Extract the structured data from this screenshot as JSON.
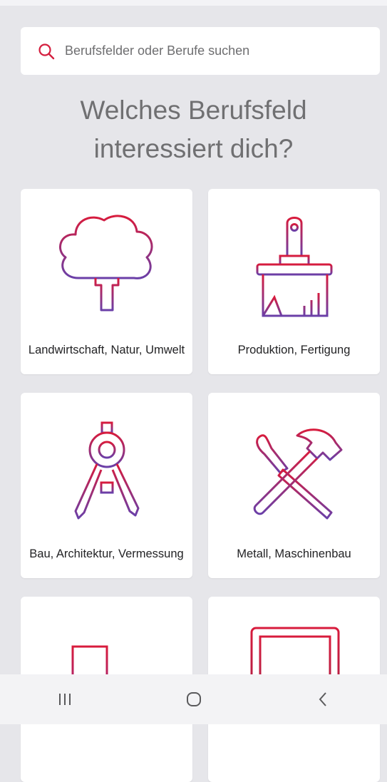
{
  "search": {
    "placeholder": "Berufsfelder oder Berufe suchen",
    "icon": "search-icon"
  },
  "heading": {
    "line1": "Welches Berufsfeld",
    "line2": "interessiert dich?"
  },
  "categories": [
    {
      "label": "Landwirtschaft, Natur, Umwelt",
      "icon": "tree-icon"
    },
    {
      "label": "Produktion, Fertigung",
      "icon": "paintbrush-icon"
    },
    {
      "label": "Bau, Architektur, Vermessung",
      "icon": "compass-icon"
    },
    {
      "label": "Metall, Maschinenbau",
      "icon": "hammer-screwdriver-icon"
    },
    {
      "label": "",
      "icon": "plug-icon"
    },
    {
      "label": "",
      "icon": "frame-icon"
    }
  ],
  "navbar": {
    "items": [
      "recent-apps",
      "home",
      "back"
    ]
  },
  "colors": {
    "gradient_start": "#d81b3c",
    "gradient_end": "#6a3fa8",
    "search_icon": "#d41e3e",
    "background": "#e6e6ea",
    "card": "#ffffff",
    "navbar": "#f3f3f5"
  }
}
